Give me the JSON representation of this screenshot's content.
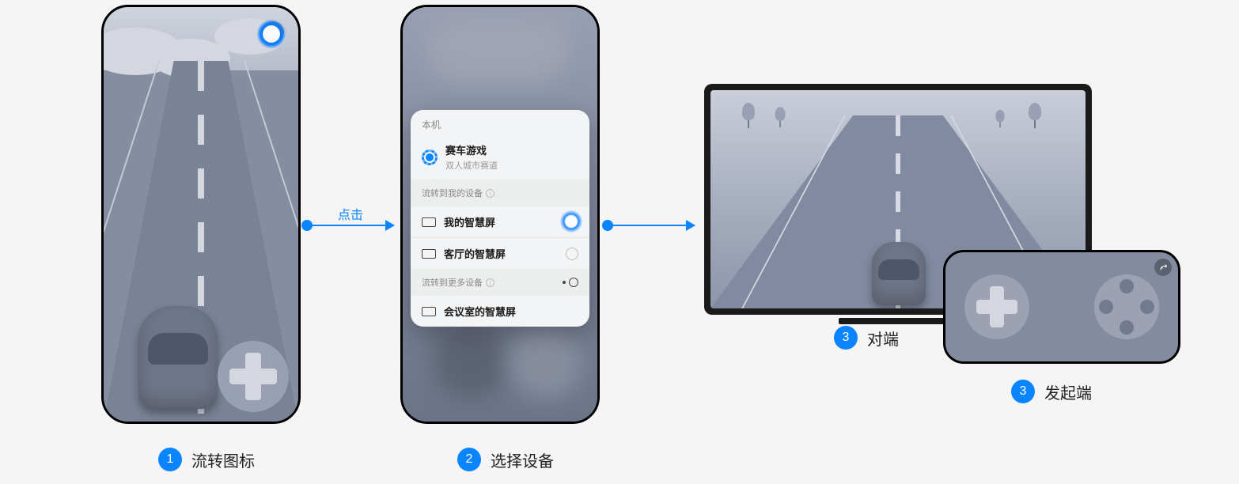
{
  "arrow_label": "点击",
  "step1": {
    "num": "1",
    "label": "流转图标"
  },
  "step2": {
    "num": "2",
    "label": "选择设备"
  },
  "step3a": {
    "num": "3",
    "label": "对端"
  },
  "step3b": {
    "num": "3",
    "label": "发起端"
  },
  "panel": {
    "local_label": "本机",
    "app_name": "赛车游戏",
    "app_sub": "双人城市赛道",
    "section_my": "流转到我的设备",
    "device_my_1": "我的智慧屏",
    "device_my_2": "客厅的智慧屏",
    "section_more": "流转到更多设备",
    "device_more_1": "会议室的智慧屏"
  }
}
